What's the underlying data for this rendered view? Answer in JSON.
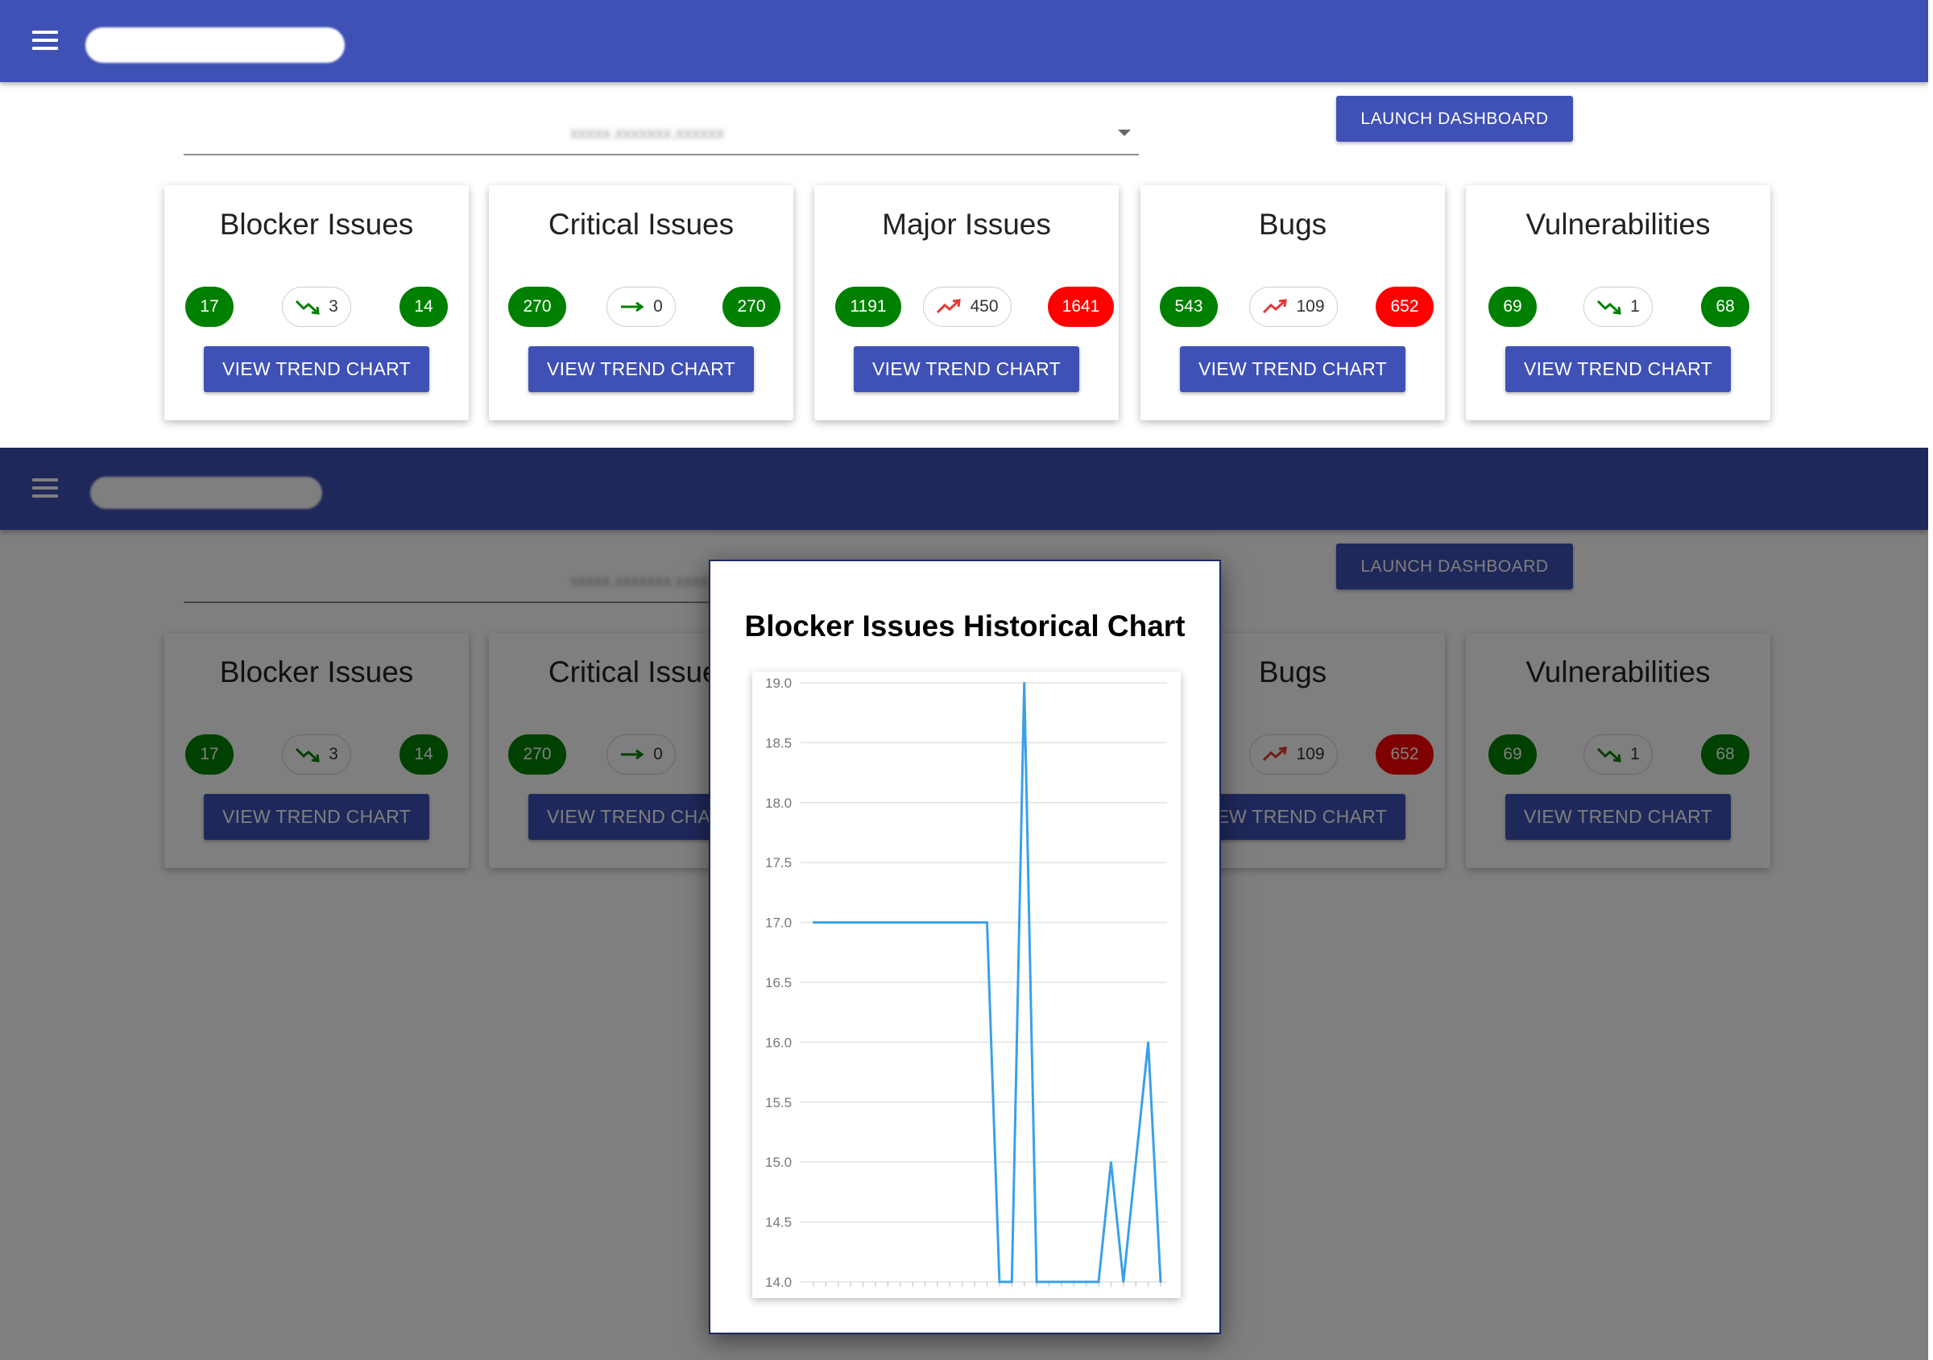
{
  "app": {
    "launch_label": "LAUNCH DASHBOARD",
    "trend_label": "VIEW TREND CHART"
  },
  "cards": [
    {
      "title": "Blocker Issues",
      "previous": "17",
      "change": "3",
      "trend": "down",
      "current": "14",
      "current_status": "good"
    },
    {
      "title": "Critical Issues",
      "previous": "270",
      "change": "0",
      "trend": "flat",
      "current": "270",
      "current_status": "good"
    },
    {
      "title": "Major Issues",
      "previous": "1191",
      "change": "450",
      "trend": "up",
      "current": "1641",
      "current_status": "bad"
    },
    {
      "title": "Bugs",
      "previous": "543",
      "change": "109",
      "trend": "up",
      "current": "652",
      "current_status": "bad"
    },
    {
      "title": "Vulnerabilities",
      "previous": "69",
      "change": "1",
      "trend": "down",
      "current": "68",
      "current_status": "good"
    }
  ],
  "colors": {
    "primary": "#3f51b5",
    "dark_primary": "#1f2859",
    "good": "#008000",
    "bad": "#ff0000",
    "trend_down": "#008000",
    "trend_up": "#e53935",
    "line": "#3aa0e8"
  },
  "dialog": {
    "title": "Blocker Issues Historical Chart"
  },
  "chart_data": {
    "type": "line",
    "title": "Blocker Issues Historical Chart",
    "xlabel": "",
    "ylabel": "",
    "ylim": [
      14.0,
      19.0
    ],
    "yticks": [
      "19.0",
      "18.5",
      "18.0",
      "17.5",
      "17.0",
      "16.5",
      "16.0",
      "15.5",
      "15.0",
      "14.5",
      "14.0"
    ],
    "grid": true,
    "series": [
      {
        "values": [
          17,
          17,
          17,
          17,
          17,
          17,
          17,
          17,
          17,
          17,
          17,
          17,
          17,
          17,
          17,
          14,
          14,
          19,
          14,
          14,
          14,
          14,
          14,
          14,
          15,
          14,
          15,
          16,
          14
        ]
      }
    ]
  }
}
